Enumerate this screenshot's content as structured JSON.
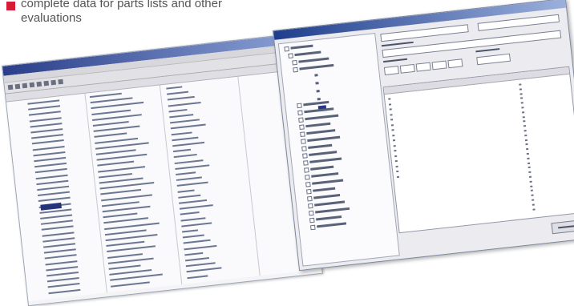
{
  "caption": {
    "line1": "complete data for parts lists and other",
    "line2": "evaluations"
  },
  "colors": {
    "bullet": "#d41c36",
    "caption_text": "#555555",
    "titlebar": "#2a3e8a",
    "selection": "#25337a"
  },
  "screenshot_parts_list": {
    "selected_row_index": 18,
    "row_count": 34
  },
  "screenshot_tree_dialog": {
    "tree_node_count": 22,
    "expanded_node_children": 4
  }
}
